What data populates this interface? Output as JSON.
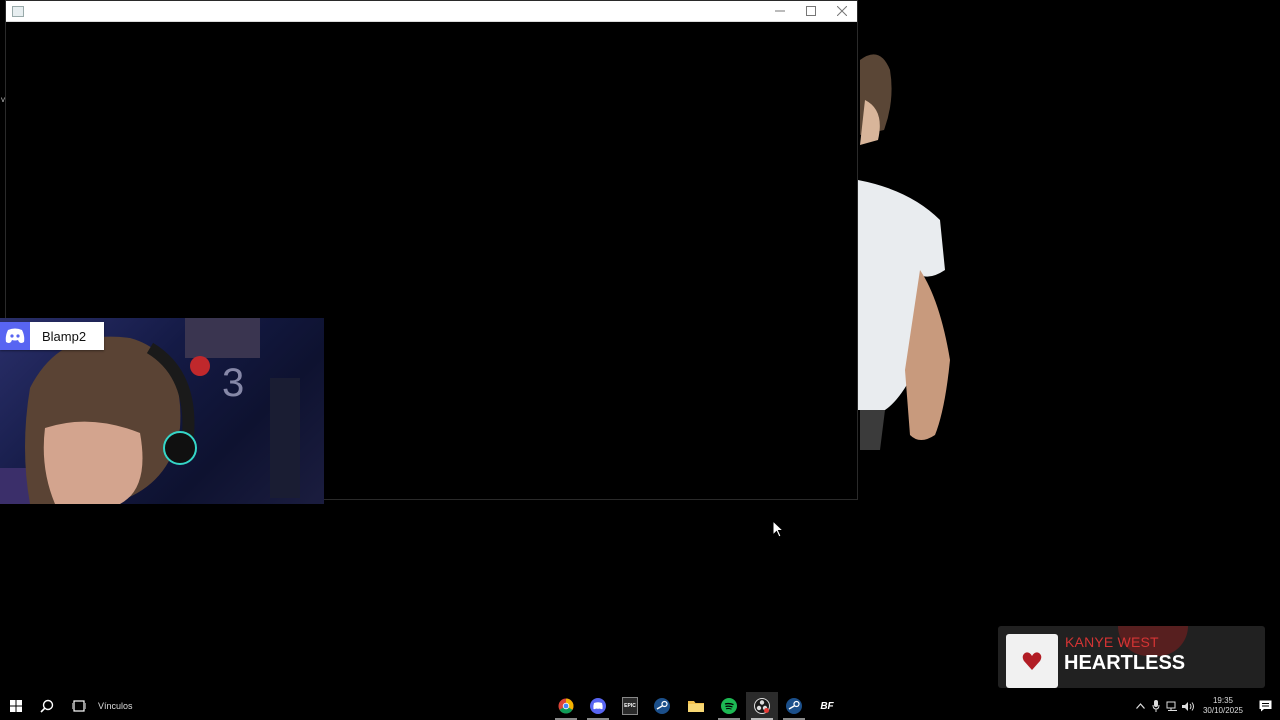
{
  "discord": {
    "username": "Blamp2"
  },
  "now_playing": {
    "artist": "KANYE WEST",
    "title": "HEARTLESS"
  },
  "taskbar": {
    "links_toolbar_label": "Vínculos",
    "apps": [
      {
        "name": "chrome",
        "label": ""
      },
      {
        "name": "discord",
        "label": ""
      },
      {
        "name": "epic-games",
        "label": "EPIC"
      },
      {
        "name": "steam",
        "label": ""
      },
      {
        "name": "file-explorer",
        "label": ""
      },
      {
        "name": "spotify",
        "label": ""
      },
      {
        "name": "obs-studio",
        "label": ""
      },
      {
        "name": "steam-2",
        "label": ""
      },
      {
        "name": "bf",
        "label": "BF"
      }
    ],
    "clock": {
      "time": "19:35",
      "date": "30/10/2025"
    }
  },
  "window": {
    "left_edge_glyph": "v"
  },
  "colors": {
    "discord_brand": "#5865F2",
    "artist_red": "#d43434",
    "spotify_green": "#1DB954"
  }
}
